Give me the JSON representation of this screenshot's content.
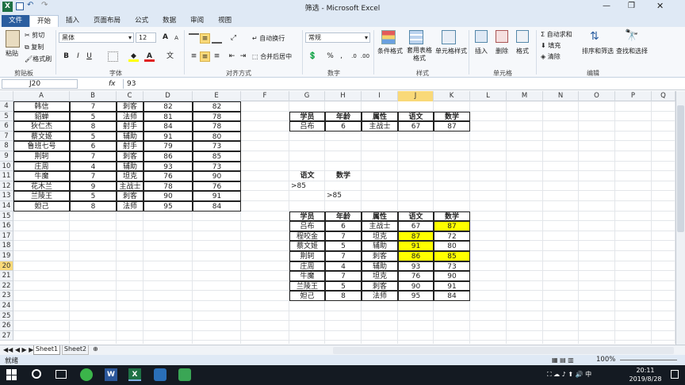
{
  "window": {
    "title": "筛选 - Microsoft Excel"
  },
  "tabs": [
    "文件",
    "开始",
    "插入",
    "页面布局",
    "公式",
    "数据",
    "审阅",
    "视图"
  ],
  "ribbon": {
    "clipboard": {
      "paste": "粘贴",
      "cut": "剪切",
      "copy": "复制",
      "format_painter": "格式刷",
      "label": "剪贴板"
    },
    "font": {
      "name": "黑体",
      "size": "12",
      "label": "字体",
      "bold": "B",
      "italic": "I",
      "underline": "U",
      "grow": "A",
      "shrink": "A"
    },
    "alignment": {
      "wrap": "自动换行",
      "merge": "合并后居中",
      "label": "对齐方式"
    },
    "number": {
      "format": "常规",
      "percent": "%",
      "comma": ",",
      "label": "数字"
    },
    "styles": {
      "conditional": "条件格式",
      "table": "套用表格格式",
      "cell": "单元格样式",
      "label": "样式"
    },
    "cells": {
      "insert": "插入",
      "delete": "删除",
      "format": "格式",
      "label": "单元格"
    },
    "editing": {
      "autosum": "自动求和",
      "fill": "填充",
      "clear": "清除",
      "sort": "排序和筛选",
      "find": "查找和选择",
      "label": "编辑"
    }
  },
  "formula_bar": {
    "name_box": "J20",
    "fx": "fx",
    "value": "93"
  },
  "columns": [
    "A",
    "B",
    "C",
    "D",
    "E",
    "F",
    "G",
    "H",
    "I",
    "J",
    "K",
    "L",
    "M",
    "N",
    "O",
    "P",
    "Q"
  ],
  "rows": [
    "4",
    "5",
    "6",
    "7",
    "8",
    "9",
    "10",
    "11",
    "12",
    "13",
    "14",
    "15",
    "16",
    "17",
    "18",
    "19",
    "20",
    "21",
    "22",
    "23",
    "24",
    "25",
    "26",
    "27"
  ],
  "left_table": [
    [
      "韩信",
      "7",
      "刺客",
      "82",
      "82"
    ],
    [
      "貂蝉",
      "5",
      "法师",
      "81",
      "78"
    ],
    [
      "狄仁杰",
      "8",
      "射手",
      "84",
      "78"
    ],
    [
      "蔡文姬",
      "5",
      "辅助",
      "91",
      "80"
    ],
    [
      "鲁班七号",
      "6",
      "射手",
      "79",
      "73"
    ],
    [
      "荆轲",
      "7",
      "刺客",
      "86",
      "85"
    ],
    [
      "庄周",
      "4",
      "辅助",
      "93",
      "73"
    ],
    [
      "牛魔",
      "7",
      "坦克",
      "76",
      "90"
    ],
    [
      "花木兰",
      "9",
      "主战士",
      "78",
      "76"
    ],
    [
      "兰陵王",
      "5",
      "刺客",
      "90",
      "91"
    ],
    [
      "妲己",
      "8",
      "法师",
      "95",
      "84"
    ]
  ],
  "top_result": {
    "headers": [
      "学员",
      "年龄",
      "属性",
      "语文",
      "数学"
    ],
    "row": [
      "吕布",
      "6",
      "主战士",
      "67",
      "87"
    ]
  },
  "criteria": {
    "headers": [
      "语文",
      "数学"
    ],
    "row1": ">85",
    "row2": ">85"
  },
  "bottom_table": {
    "headers": [
      "学员",
      "年龄",
      "属性",
      "语文",
      "数学"
    ],
    "rows": [
      [
        "吕布",
        "6",
        "主战士",
        "67",
        "87"
      ],
      [
        "程咬金",
        "7",
        "坦克",
        "87",
        "72"
      ],
      [
        "蔡文姬",
        "5",
        "辅助",
        "91",
        "80"
      ],
      [
        "荆轲",
        "7",
        "刺客",
        "86",
        "85"
      ],
      [
        "庄周",
        "4",
        "辅助",
        "93",
        "73"
      ],
      [
        "牛魔",
        "7",
        "坦克",
        "76",
        "90"
      ],
      [
        "兰陵王",
        "5",
        "刺客",
        "90",
        "91"
      ],
      [
        "妲己",
        "8",
        "法师",
        "95",
        "84"
      ]
    ]
  },
  "highlight_color": "#ffff00",
  "sheets": [
    "Sheet1",
    "Sheet2"
  ],
  "status": {
    "ready": "就绪",
    "zoom": "100%"
  },
  "taskbar": {
    "time": "20:11",
    "date": "2019/8/28"
  }
}
